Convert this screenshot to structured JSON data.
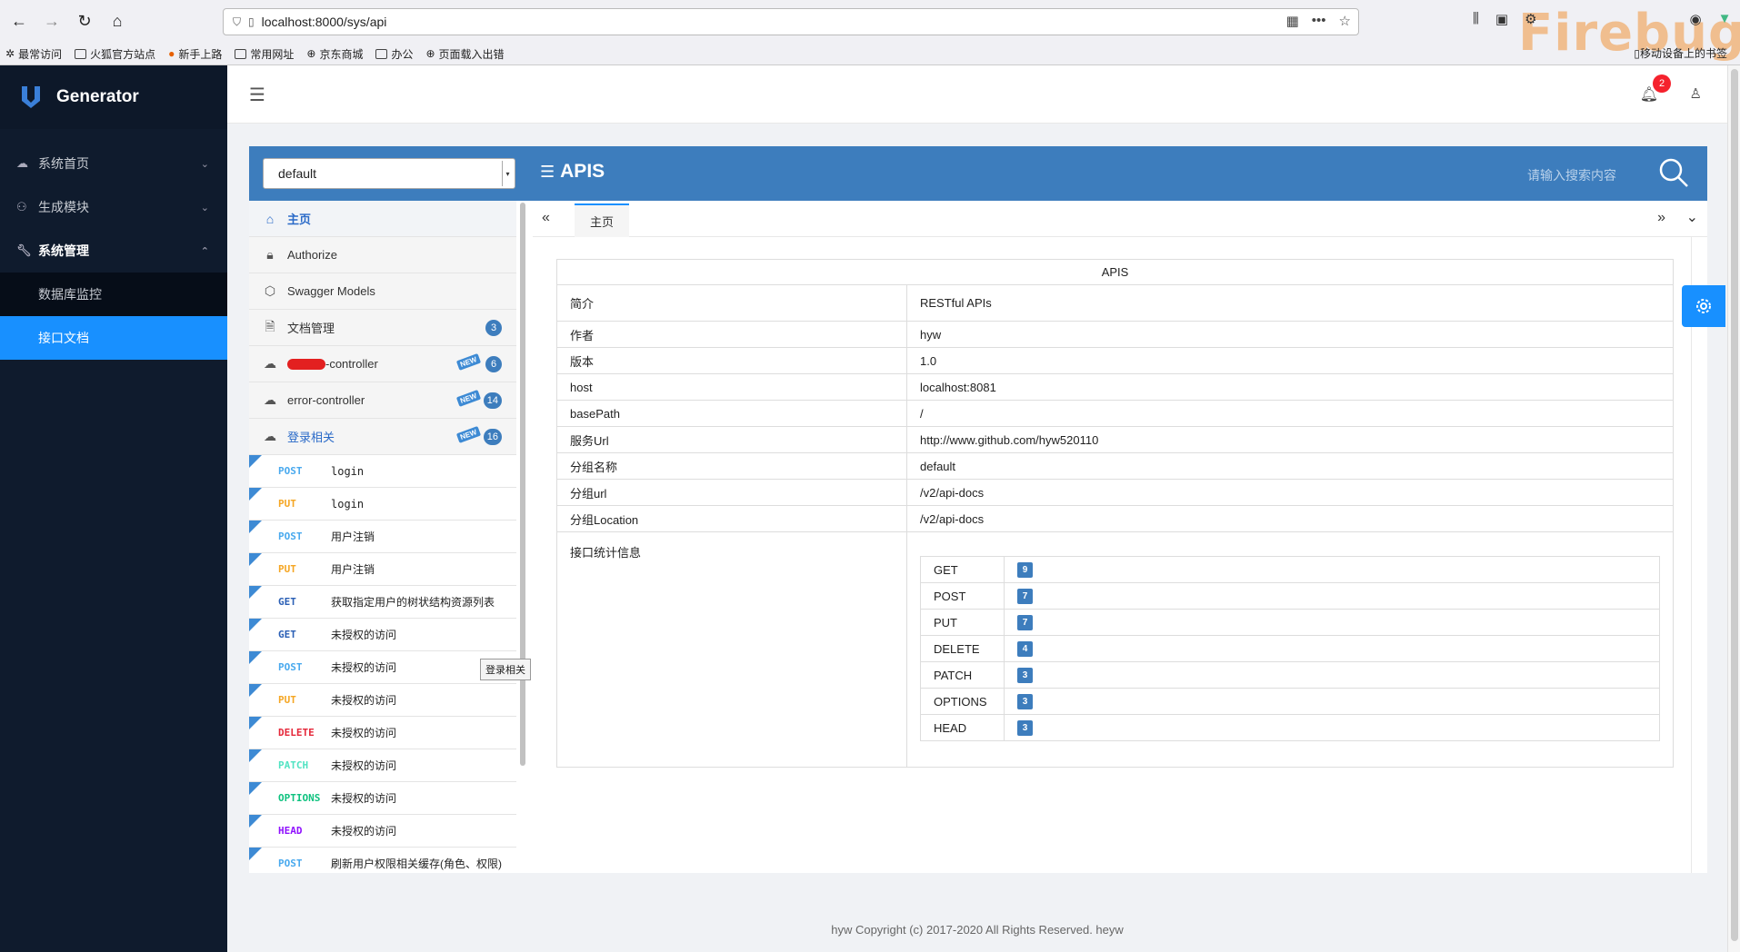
{
  "browser": {
    "url": "localhost:8000/sys/api",
    "bookmarks": [
      "最常访问",
      "火狐官方站点",
      "新手上路",
      "常用网址",
      "京东商城",
      "办公",
      "页面载入出错"
    ],
    "mobile_bookmarks": "移动设备上的书签",
    "firebug_watermark": "Firebug"
  },
  "sidebar": {
    "brand": "Generator",
    "items": [
      {
        "label": "系统首页",
        "icon": "cloud-icon"
      },
      {
        "label": "生成模块",
        "icon": "sitemap-icon"
      },
      {
        "label": "系统管理",
        "icon": "wrench-icon"
      }
    ],
    "sub_items": [
      {
        "label": "数据库监控",
        "active": false
      },
      {
        "label": "接口文档",
        "active": true
      }
    ]
  },
  "header": {
    "notification_count": "2"
  },
  "swagger": {
    "group_value": "default",
    "title": "APIS",
    "search_placeholder": "请输入搜索内容",
    "nav": [
      {
        "label": "主页",
        "icon": "home-icon",
        "kind": "home"
      },
      {
        "label": "Authorize",
        "icon": "lock-icon",
        "kind": "plain"
      },
      {
        "label": "Swagger Models",
        "icon": "cube-icon",
        "kind": "plain"
      },
      {
        "label": "文档管理",
        "icon": "doc-settings-icon",
        "kind": "plain",
        "count": "3"
      },
      {
        "label": "-controller",
        "icon": "cloud-icon",
        "kind": "plain",
        "count": "6",
        "new": true,
        "redacted_prefix": true
      },
      {
        "label": "error-controller",
        "icon": "cloud-icon",
        "kind": "plain",
        "count": "14",
        "new": true
      },
      {
        "label": "登录相关",
        "icon": "cloud-icon",
        "kind": "active",
        "count": "16",
        "new": true
      }
    ],
    "new_tag": "NEW",
    "apis": [
      {
        "method": "POST",
        "name": "login"
      },
      {
        "method": "PUT",
        "name": "login"
      },
      {
        "method": "POST",
        "name": "用户注销"
      },
      {
        "method": "PUT",
        "name": "用户注销"
      },
      {
        "method": "GET",
        "name": "获取指定用户的树状结构资源列表"
      },
      {
        "method": "GET",
        "name": "未授权的访问"
      },
      {
        "method": "POST",
        "name": "未授权的访问"
      },
      {
        "method": "PUT",
        "name": "未授权的访问"
      },
      {
        "method": "DELETE",
        "name": "未授权的访问"
      },
      {
        "method": "PATCH",
        "name": "未授权的访问"
      },
      {
        "method": "OPTIONS",
        "name": "未授权的访问"
      },
      {
        "method": "HEAD",
        "name": "未授权的访问"
      },
      {
        "method": "POST",
        "name": "刷新用户权限相关缓存(角色、权限)"
      }
    ],
    "tooltip": "登录相关",
    "tab_label": "主页",
    "info_caption": "APIS",
    "info": [
      {
        "k": "简介",
        "v": "RESTful APIs"
      },
      {
        "k": "作者",
        "v": "hyw"
      },
      {
        "k": "版本",
        "v": "1.0"
      },
      {
        "k": "host",
        "v": "localhost:8081"
      },
      {
        "k": "basePath",
        "v": "/"
      },
      {
        "k": "服务Url",
        "v": "http://www.github.com/hyw520110"
      },
      {
        "k": "分组名称",
        "v": "default"
      },
      {
        "k": "分组url",
        "v": "/v2/api-docs"
      },
      {
        "k": "分组Location",
        "v": "/v2/api-docs"
      }
    ],
    "stats_label": "接口统计信息",
    "stats": [
      {
        "method": "GET",
        "count": "9"
      },
      {
        "method": "POST",
        "count": "7"
      },
      {
        "method": "PUT",
        "count": "7"
      },
      {
        "method": "DELETE",
        "count": "4"
      },
      {
        "method": "PATCH",
        "count": "3"
      },
      {
        "method": "OPTIONS",
        "count": "3"
      },
      {
        "method": "HEAD",
        "count": "3"
      }
    ]
  },
  "footer": "hyw Copyright (c) 2017-2020 All Rights Reserved. heyw"
}
